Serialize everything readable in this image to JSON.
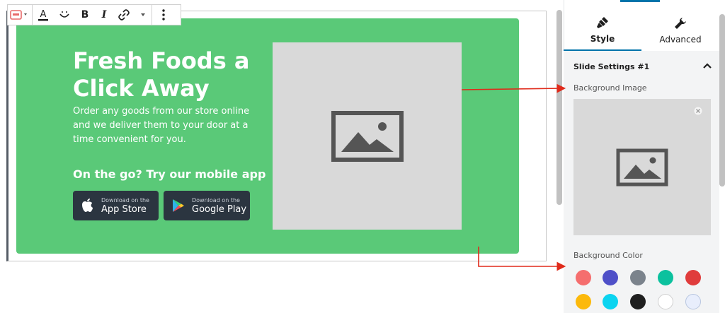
{
  "toolbar": {
    "items": [
      "block-type",
      "text-color",
      "highlight",
      "bold",
      "italic",
      "link",
      "more-formats",
      "options"
    ],
    "bold_label": "B",
    "italic_label": "I"
  },
  "slide": {
    "headline": "Fresh Foods a Click Away",
    "description": "Order any goods from our store online and we deliver them to your door at a time convenient for you.",
    "app_heading": "On the go? Try our mobile app",
    "app_store": {
      "small": "Download on the",
      "big": "App Store"
    },
    "google_play": {
      "small": "Download on the",
      "big": "Google Play"
    },
    "background_color": "#5ac978"
  },
  "panel": {
    "tabs": [
      {
        "label": "Style",
        "icon": "brush-icon",
        "active": true
      },
      {
        "label": "Advanced",
        "icon": "wrench-icon",
        "active": false
      }
    ],
    "section_title": "Slide Settings #1",
    "background_image_label": "Background Image",
    "background_color_label": "Background Color",
    "colors": [
      "#f56e6e",
      "#4f50c8",
      "#7b838c",
      "#0cc19e",
      "#e03c3c",
      "#fcb90b",
      "#0bd4f0",
      "#1f1f1f",
      "#ffffff",
      "#e8eefc"
    ]
  },
  "accent": "#0073aa",
  "annotation_color": "#e02a1a"
}
